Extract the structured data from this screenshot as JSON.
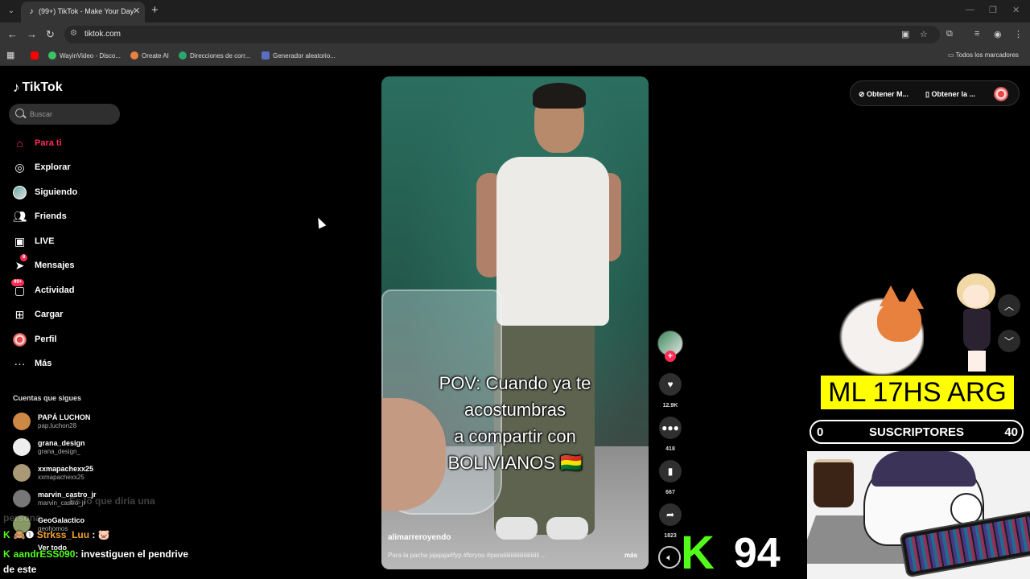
{
  "browser": {
    "tab_title": "(99+) TikTok - Make Your Day",
    "tab_favicon": "tiktok-icon",
    "url": "tiktok.com",
    "bookmarks": [
      {
        "label": "",
        "icon": "youtube-icon",
        "color": "#ff0000"
      },
      {
        "label": "WayinVideo - Disco...",
        "icon": "wayin-icon",
        "color": "#3ac264"
      },
      {
        "label": "Oreate AI",
        "icon": "oreate-icon",
        "color": "#e8813e"
      },
      {
        "label": "Direcciones de corr...",
        "icon": "mail-icon",
        "color": "#2aa86c"
      },
      {
        "label": "Generador aleatorio...",
        "icon": "generator-icon",
        "color": "#5a6fc0"
      }
    ],
    "all_bookmarks": "Todos los marcadores"
  },
  "sidebar": {
    "logo": "TikTok",
    "search_placeholder": "Buscar",
    "nav": [
      {
        "label": "Para ti",
        "icon": "home-icon",
        "active": true
      },
      {
        "label": "Explorar",
        "icon": "compass-icon"
      },
      {
        "label": "Siguiendo",
        "icon": "following-avatar-icon"
      },
      {
        "label": "Friends",
        "icon": "friends-icon"
      },
      {
        "label": "LIVE",
        "icon": "live-tv-icon"
      },
      {
        "label": "Mensajes",
        "icon": "send-icon",
        "badge": "8"
      },
      {
        "label": "Actividad",
        "icon": "inbox-icon",
        "badge": "99+"
      },
      {
        "label": "Cargar",
        "icon": "upload-icon"
      },
      {
        "label": "Perfil",
        "icon": "profile-avatar-icon"
      },
      {
        "label": "Más",
        "icon": "more-icon"
      }
    ],
    "following_title": "Cuentas que sigues",
    "following": [
      {
        "name": "PAPÁ LUCHON",
        "user": "pap.luchon28",
        "color": "#c84"
      },
      {
        "name": "grana_design",
        "user": "grana_design_",
        "color": "#eee"
      },
      {
        "name": "xxmapachexx25",
        "user": "xxmapachexx25",
        "color": "#a97"
      },
      {
        "name": "marvin_castro_jr",
        "user": "marvin_castro_jr",
        "color": "#777"
      },
      {
        "name": "GeoGalactico",
        "user": "geohomos",
        "color": "#896"
      },
      {
        "name": "Ver todo",
        "user": "",
        "color": ""
      }
    ]
  },
  "chat": {
    "faded_line_1": "Es lo que diría una",
    "faded_line_2": "persona",
    "line1_user": "Strkss_Luu",
    "line1_sep": ":",
    "line2_user": "aandrESS090",
    "line2_text": ": investiguen el pendrive",
    "line3_text": "de este"
  },
  "video": {
    "caption_lines": [
      "POV: Cuando ya te",
      "acostumbras",
      "a compartir con",
      "BOLIVIANOS 🇧🇴"
    ],
    "author": "alimarreroyendo",
    "description": "Para la pacha jajajaja#fyp #foryou #paratiiiiiiiiiiiiiiiiiiiiiiii ...",
    "more": "más",
    "likes": "12.9K",
    "comments": "418",
    "saves": "667",
    "shares": "1823"
  },
  "top_actions": {
    "get_app_1": "Obtener M...",
    "get_app_2": "Obtener la ..."
  },
  "stream": {
    "banner": "ML 17HS ARG",
    "subs_left": "0",
    "subs_label": "SUSCRIPTORES",
    "subs_right": "40",
    "kick_logo": "K",
    "kick_count": "94",
    "banner_color": "#ffff00",
    "kick_color": "#53fc18"
  },
  "colors": {
    "accent": "#fe2c55"
  }
}
